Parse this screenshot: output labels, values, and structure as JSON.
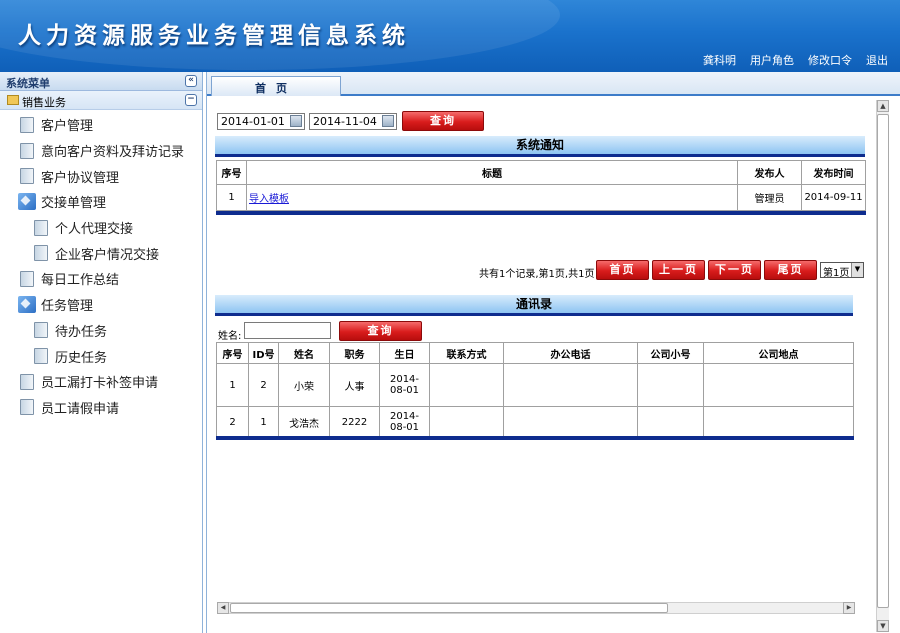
{
  "header": {
    "title": "人力资源服务业务管理信息系统",
    "links": [
      "龚科明",
      "用户角色",
      "修改口令",
      "退出"
    ]
  },
  "sidebar": {
    "title": "系统菜单",
    "collapse_glyph": "«",
    "section": "销售业务",
    "section_glyph": "−",
    "items": [
      {
        "label": "客户管理",
        "level": 1,
        "icon": "document-icon"
      },
      {
        "label": "意向客户资料及拜访记录",
        "level": 1,
        "icon": "document-icon"
      },
      {
        "label": "客户协议管理",
        "level": 1,
        "icon": "document-icon"
      },
      {
        "label": "交接单管理",
        "level": 1,
        "icon": "folder-icon"
      },
      {
        "label": "个人代理交接",
        "level": 2,
        "icon": "document-icon"
      },
      {
        "label": "企业客户情况交接",
        "level": 2,
        "icon": "document-icon"
      },
      {
        "label": "每日工作总结",
        "level": 1,
        "icon": "document-icon"
      },
      {
        "label": "任务管理",
        "level": 1,
        "icon": "folder-icon"
      },
      {
        "label": "待办任务",
        "level": 2,
        "icon": "document-icon"
      },
      {
        "label": "历史任务",
        "level": 2,
        "icon": "document-icon"
      },
      {
        "label": "员工漏打卡补签申请",
        "level": 1,
        "icon": "document-icon"
      },
      {
        "label": "员工请假申请",
        "level": 1,
        "icon": "document-icon"
      }
    ]
  },
  "tabs": {
    "home": "首页"
  },
  "filter": {
    "start_date": "2014-01-01",
    "end_date": "2014-11-04",
    "query_label": "查询"
  },
  "notice": {
    "title": "系统通知",
    "columns": [
      "序号",
      "标题",
      "发布人",
      "发布时间"
    ],
    "rows": [
      {
        "index": "1",
        "title": "导入模板",
        "publisher": "管理员",
        "time": "2014-09-11"
      }
    ]
  },
  "pager": {
    "summary": "共有1个记录,第1页,共1页",
    "first": "首页",
    "prev": "上一页",
    "next": "下一页",
    "last": "尾页",
    "page_select": "第1页"
  },
  "contacts": {
    "title": "通讯录",
    "name_label": "姓名:",
    "query_label": "查询",
    "columns": [
      "序号",
      "ID号",
      "姓名",
      "职务",
      "生日",
      "联系方式",
      "办公电话",
      "公司小号",
      "公司地点"
    ],
    "rows": [
      {
        "index": "1",
        "id": "2",
        "name": "小荣",
        "position": "人事",
        "birthday": "2014-08-01",
        "contact": "",
        "office_phone": "",
        "company_short": "",
        "company_location": ""
      },
      {
        "index": "2",
        "id": "1",
        "name": "戈浩杰",
        "position": "2222",
        "birthday": "2014-08-01",
        "contact": "",
        "office_phone": "",
        "company_short": "",
        "company_location": ""
      }
    ]
  },
  "colors": {
    "header_blue": "#1a72cc",
    "panel_border": "#0e2c8e",
    "button_red": "#d91c1c"
  }
}
